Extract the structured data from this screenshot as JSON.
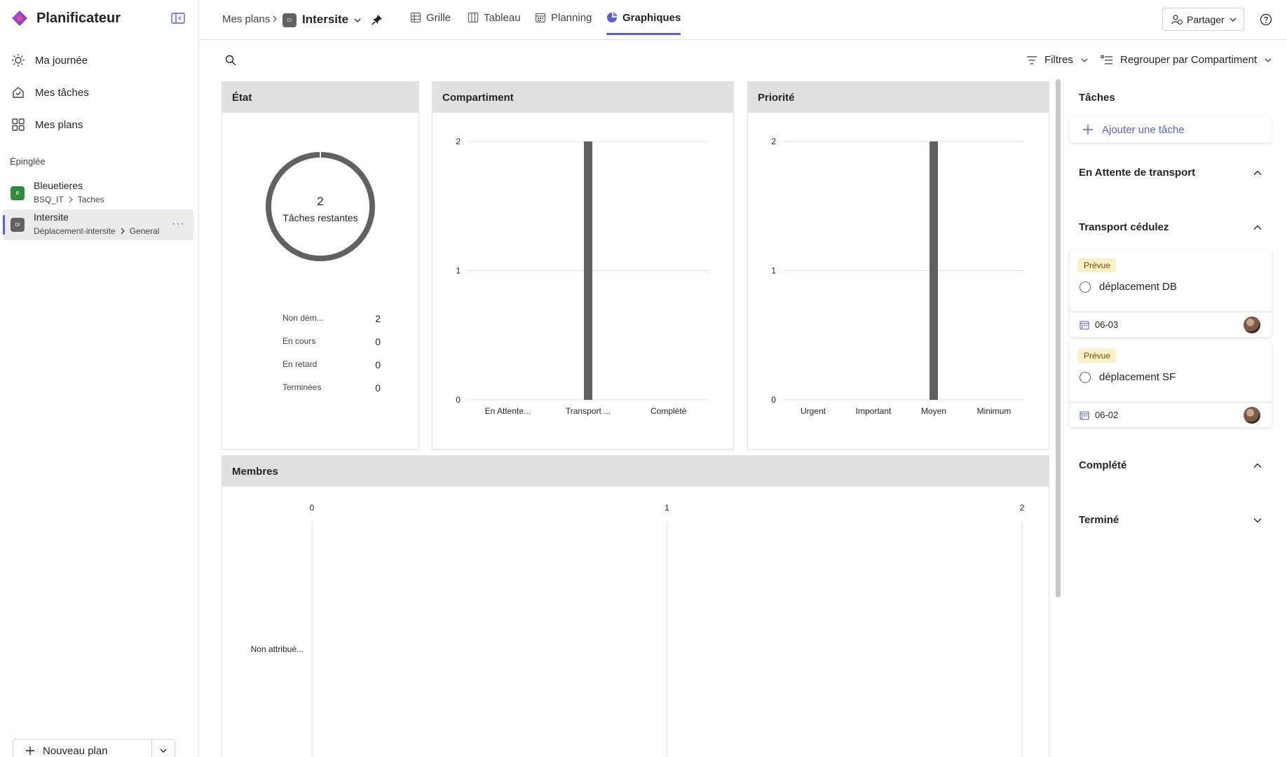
{
  "app": {
    "title": "Planificateur"
  },
  "sidebar": {
    "nav": [
      {
        "label": "Ma journée",
        "icon": "sun-icon"
      },
      {
        "label": "Mes tâches",
        "icon": "tasks-icon"
      },
      {
        "label": "Mes plans",
        "icon": "grid-icon"
      }
    ],
    "pinned_label": "Épinglée",
    "pinned": [
      {
        "name": "Bleuetieres",
        "path_group": "BSQ_IT",
        "path_channel": "Taches",
        "color": "#2e8b3a",
        "initials": "B"
      },
      {
        "name": "Intersite",
        "path_group": "Déplacement-intersite",
        "path_channel": "General",
        "color": "#616161",
        "initials": "DI"
      }
    ],
    "new_plan_label": "Nouveau plan"
  },
  "header": {
    "breadcrumb": "Mes plans",
    "plan_title": "Intersite",
    "plan_badge": "DI",
    "tabs": [
      {
        "label": "Grille",
        "icon": "grid-view-icon"
      },
      {
        "label": "Tableau",
        "icon": "board-icon"
      },
      {
        "label": "Planning",
        "icon": "calendar-icon"
      },
      {
        "label": "Graphiques",
        "icon": "chart-icon",
        "active": true
      }
    ],
    "share_label": "Partager"
  },
  "toolbar": {
    "filters_label": "Filtres",
    "group_by_label": "Regrouper par Compartiment"
  },
  "cards": {
    "state_title": "État",
    "bucket_title": "Compartiment",
    "priority_title": "Priorité",
    "members_title": "Membres"
  },
  "chart_data": [
    {
      "type": "pie",
      "title": "État",
      "center_value": "2",
      "center_label": "Tâches restantes",
      "categories": [
        "Non dém...",
        "En cours",
        "En retard",
        "Terminées"
      ],
      "values": [
        2,
        0,
        0,
        0
      ],
      "colors": [
        "#616161",
        "#8a8a8a",
        "#a4262c",
        "#5b5fc7"
      ]
    },
    {
      "type": "bar",
      "title": "Compartiment",
      "categories": [
        "En Attente...",
        "Transport ...",
        "Complété"
      ],
      "values": [
        0,
        2,
        0
      ],
      "ylim": [
        0,
        2
      ],
      "yticks": [
        0,
        1,
        2
      ],
      "color": "#616161"
    },
    {
      "type": "bar",
      "title": "Priorité",
      "categories": [
        "Urgent",
        "Important",
        "Moyen",
        "Minimum"
      ],
      "values": [
        0,
        0,
        2,
        0
      ],
      "ylim": [
        0,
        2
      ],
      "yticks": [
        0,
        1,
        2
      ],
      "color": "#616161"
    },
    {
      "type": "bar",
      "orientation": "horizontal",
      "title": "Membres",
      "categories": [
        "Non attribué..."
      ],
      "values": [
        0
      ],
      "xlim": [
        0,
        2
      ],
      "xticks": [
        0,
        1,
        2
      ],
      "color": "#616161"
    }
  ],
  "right_panel": {
    "title": "Tâches",
    "add_task_label": "Ajouter une tâche",
    "buckets": [
      {
        "name": "En Attente de transport",
        "state": "expanded"
      },
      {
        "name": "Transport cédulez",
        "state": "expanded"
      },
      {
        "name": "Complété",
        "state": "expanded"
      },
      {
        "name": "Terminé",
        "state": "collapsed"
      }
    ],
    "tasks": [
      {
        "tag": "Prévue",
        "name": "déplacement DB",
        "date": "06-03"
      },
      {
        "tag": "Prévue",
        "name": "déplacement SF",
        "date": "06-02"
      }
    ]
  }
}
